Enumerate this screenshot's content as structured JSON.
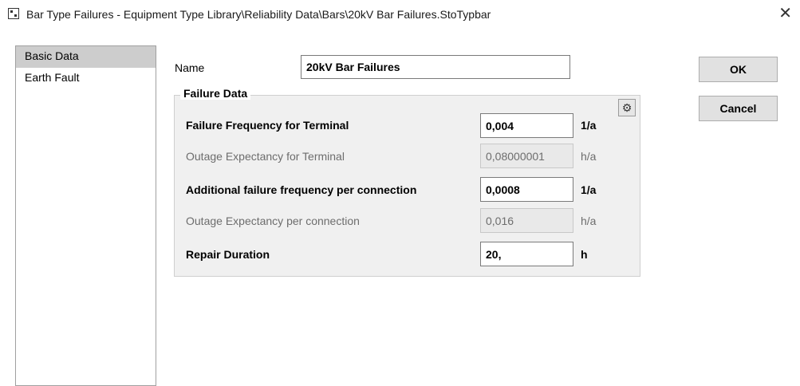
{
  "window": {
    "title": "Bar Type Failures - Equipment Type Library\\Reliability Data\\Bars\\20kV Bar Failures.StoTypbar",
    "close_glyph": "✕"
  },
  "sidebar": {
    "items": [
      {
        "label": "Basic Data",
        "selected": true
      },
      {
        "label": "Earth Fault",
        "selected": false
      }
    ]
  },
  "form": {
    "name_label": "Name",
    "name_value": "20kV Bar Failures",
    "group_title": "Failure Data",
    "fields": [
      {
        "label": "Failure Frequency for Terminal",
        "value": "0,004",
        "unit": "1/a",
        "enabled": true
      },
      {
        "label": "Outage Expectancy for Terminal",
        "value": "0,08000001",
        "unit": "h/a",
        "enabled": false
      },
      {
        "label": "Additional failure frequency per connection",
        "value": "0,0008",
        "unit": "1/a",
        "enabled": true
      },
      {
        "label": "Outage Expectancy per connection",
        "value": "0,016",
        "unit": "h/a",
        "enabled": false
      },
      {
        "label": "Repair Duration",
        "value": "20,",
        "unit": "h",
        "enabled": true
      }
    ],
    "settings_icon": "gear-icon"
  },
  "buttons": {
    "ok_label": "OK",
    "cancel_label": "Cancel"
  }
}
